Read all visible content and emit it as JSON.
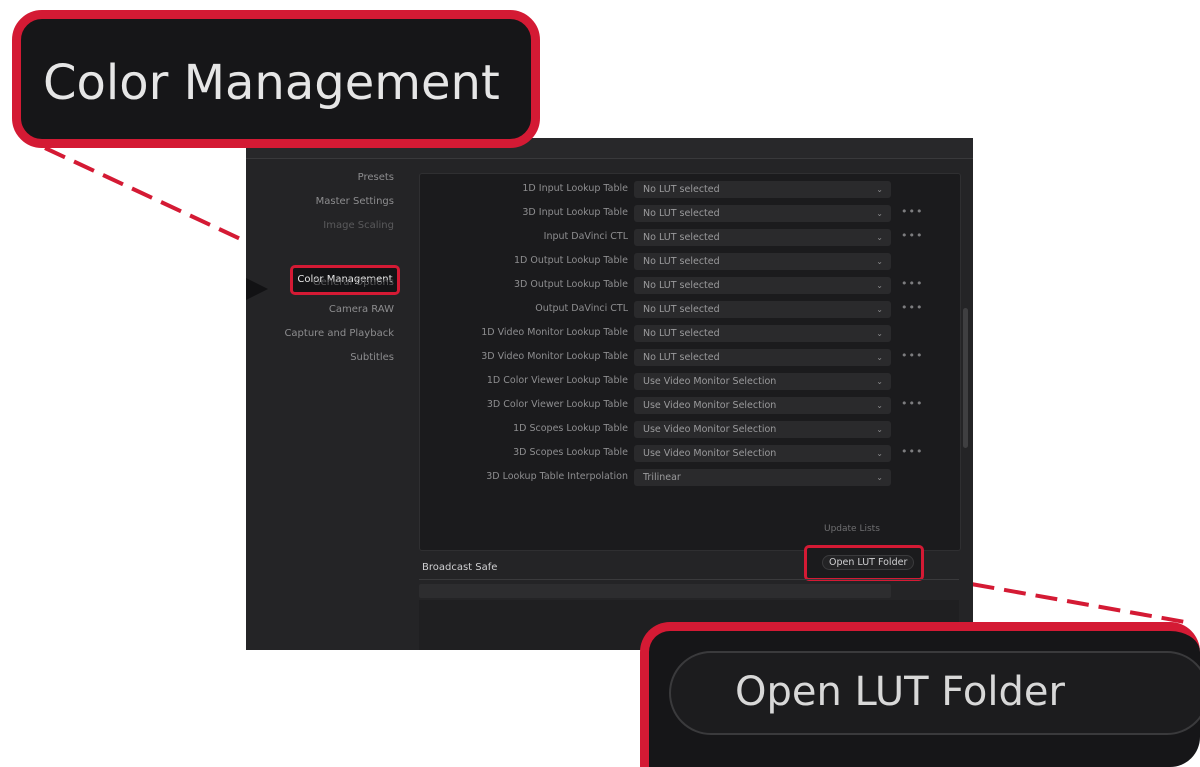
{
  "sidebar": {
    "items": [
      "Presets",
      "Master Settings",
      "Image Scaling",
      "Color Management",
      "General Options",
      "Camera RAW",
      "Capture and Playback",
      "Subtitles"
    ],
    "active": "Color Management"
  },
  "rows": [
    {
      "label": "1D Input Lookup Table",
      "value": "No LUT selected",
      "more": false
    },
    {
      "label": "3D Input Lookup Table",
      "value": "No LUT selected",
      "more": true
    },
    {
      "label": "Input DaVinci CTL",
      "value": "No LUT selected",
      "more": true
    },
    {
      "label": "1D Output Lookup Table",
      "value": "No LUT selected",
      "more": false
    },
    {
      "label": "3D Output Lookup Table",
      "value": "No LUT selected",
      "more": true
    },
    {
      "label": "Output DaVinci CTL",
      "value": "No LUT selected",
      "more": true
    },
    {
      "label": "1D Video Monitor Lookup Table",
      "value": "No LUT selected",
      "more": false
    },
    {
      "label": "3D Video Monitor Lookup Table",
      "value": "No LUT selected",
      "more": true
    },
    {
      "label": "1D Color Viewer Lookup Table",
      "value": "Use Video Monitor Selection",
      "more": false
    },
    {
      "label": "3D Color Viewer Lookup Table",
      "value": "Use Video Monitor Selection",
      "more": true
    },
    {
      "label": "1D Scopes Lookup Table",
      "value": "Use Video Monitor Selection",
      "more": false
    },
    {
      "label": "3D Scopes Lookup Table",
      "value": "Use Video Monitor Selection",
      "more": true
    },
    {
      "label": "3D Lookup Table Interpolation",
      "value": "Trilinear",
      "more": false
    }
  ],
  "more_glyph": "•••",
  "chevron_glyph": "⌄",
  "buttons": {
    "update_luts": "Update Lists",
    "open_lut_folder": "Open LUT Folder"
  },
  "broadcast_safe": {
    "title": "Broadcast Safe"
  },
  "callouts": {
    "color_management": "Color Management",
    "open_lut_folder": "Open LUT Folder"
  },
  "colors": {
    "highlight": "#d41a34",
    "window_bg": "#242426"
  }
}
